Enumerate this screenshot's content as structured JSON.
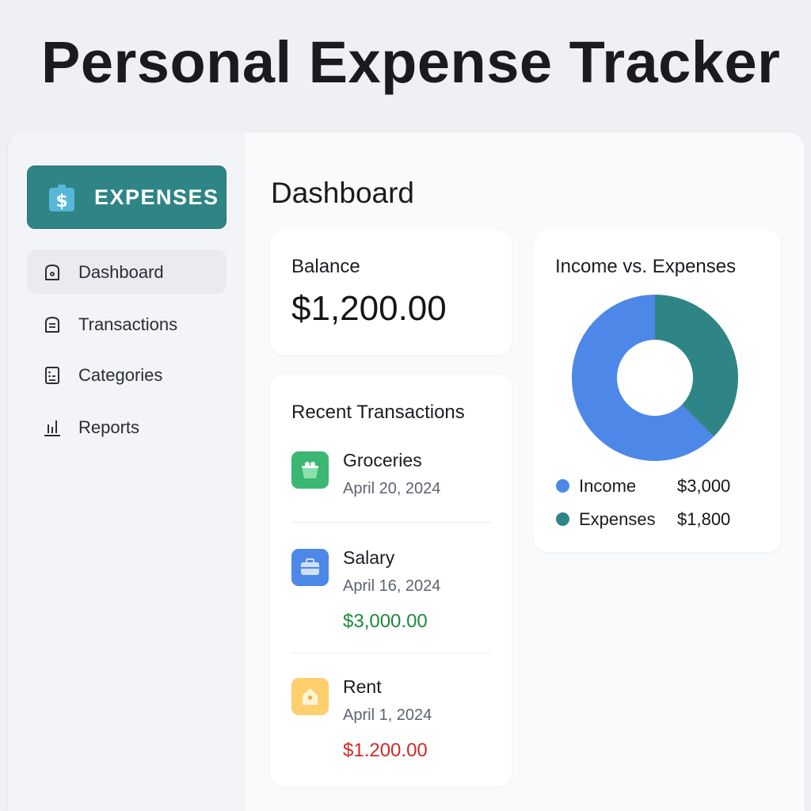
{
  "header": {
    "title": "Personal Expense Tracker"
  },
  "brand": {
    "label": "EXPENSES",
    "icon": "dollar-tag-icon",
    "color": "#2f8585"
  },
  "sidebar": {
    "items": [
      {
        "label": "Dashboard",
        "icon": "home-icon",
        "active": true
      },
      {
        "label": "Transactions",
        "icon": "list-icon",
        "active": false
      },
      {
        "label": "Categories",
        "icon": "categories-icon",
        "active": false
      },
      {
        "label": "Reports",
        "icon": "bar-chart-icon",
        "active": false
      }
    ]
  },
  "main": {
    "title": "Dashboard",
    "balance": {
      "label": "Balance",
      "value": "$1,200.00"
    },
    "recent": {
      "title": "Recent Transactions",
      "items": [
        {
          "name": "Groceries",
          "date": "April 20, 2024",
          "amount": "",
          "icon": "basket-icon",
          "icon_color": "#3bb673"
        },
        {
          "name": "Salary",
          "date": "April 16, 2024",
          "amount": "$3,000.00",
          "amount_color": "#1c8a3d",
          "icon": "briefcase-icon",
          "icon_color": "#4d88e8"
        },
        {
          "name": "Rent",
          "date": "April 1, 2024",
          "amount": "$1.200.00",
          "amount_color": "#d02a26",
          "icon": "house-icon",
          "icon_color": "#ffcf6e"
        }
      ]
    },
    "income_expenses": {
      "title": "Income vs. Expenses",
      "legend": [
        {
          "label": "Income",
          "value": "$3,000",
          "color": "#4d88e8"
        },
        {
          "label": "Expenses",
          "value": "$1,800",
          "color": "#2f8585"
        }
      ]
    }
  },
  "chart_data": {
    "type": "pie",
    "categories": [
      "Income",
      "Expenses"
    ],
    "values": [
      3000,
      1800
    ],
    "colors": [
      "#4d88e8",
      "#2f8585"
    ],
    "title": "Income vs. Expenses",
    "donut": true
  }
}
